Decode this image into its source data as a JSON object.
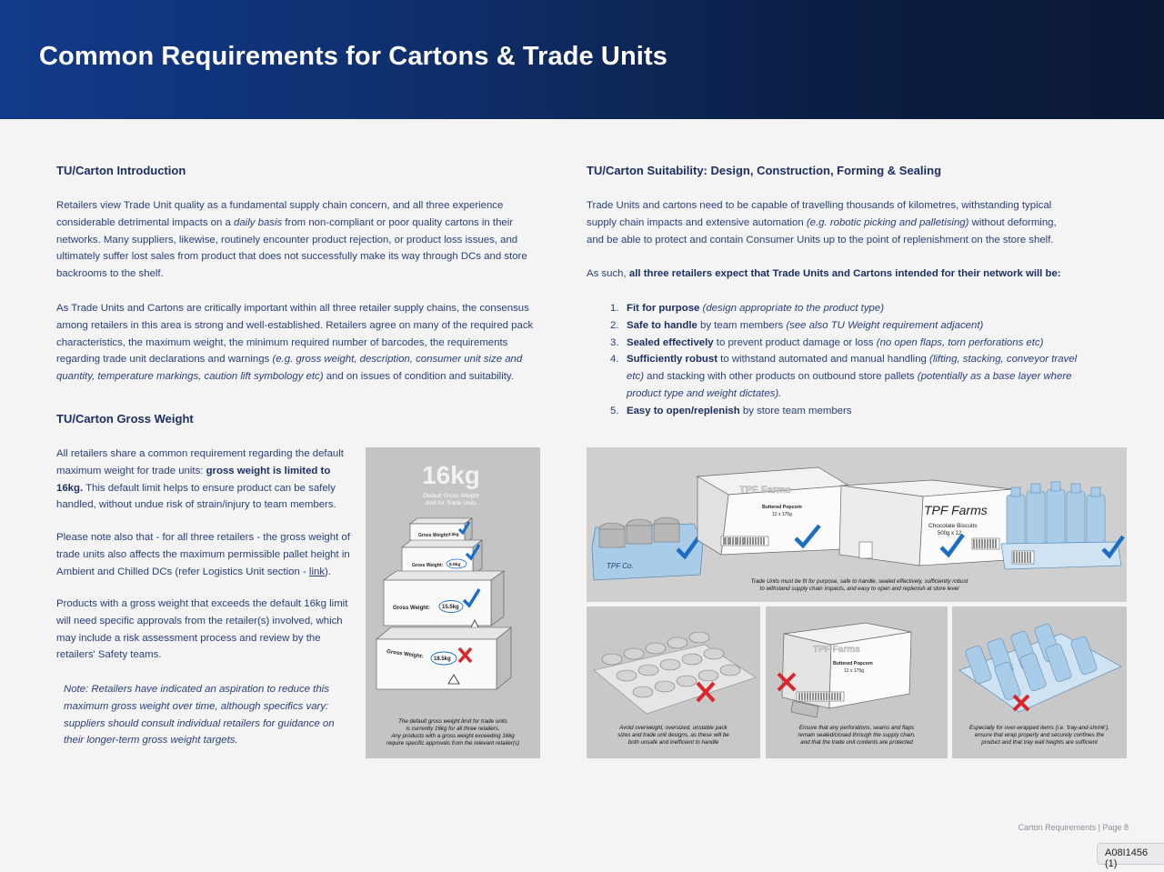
{
  "header": {
    "title": "Common Requirements for Cartons & Trade Units"
  },
  "left": {
    "intro_heading": "TU/Carton Introduction",
    "intro_p1_a": "Retailers view Trade Unit quality as a fundamental supply chain concern, and all three experience considerable detrimental impacts on a ",
    "intro_p1_i": "daily basis",
    "intro_p1_b": " from non-compliant or poor quality cartons in their networks.  Many suppliers, likewise, routinely encounter product rejection, or product loss issues, and ultimately suffer lost sales from product that does not successfully make its way through DCs and store backrooms to the shelf.",
    "intro_p2_a": "As Trade Units and Cartons are critically important within all three retailer supply chains, the consensus among retailers in this area is strong and well-established.  Retailers agree on many of the required pack characteristics, the maximum weight, the minimum required number of barcodes, the requirements regarding trade unit declarations and warnings ",
    "intro_p2_i": "(e.g. gross weight, description, consumer unit size and quantity, temperature markings, caution lift symbology etc)",
    "intro_p2_b": " and on issues of condition and suitability.",
    "weight_heading": "TU/Carton Gross Weight",
    "weight_p1_a": "All retailers share a common requirement regarding the default maximum weight for trade units: ",
    "weight_p1_b": "gross weight is limited to 16kg.",
    "weight_p1_c": "  This default limit helps to ensure product can be safely handled, without undue risk of strain/injury to team members.",
    "weight_p2_a": "Please note also that - for all three retailers - the gross weight of trade units also affects the maximum permissible pallet height in Ambient and Chilled DCs (refer Logistics Unit section - ",
    "weight_p2_link": "link",
    "weight_p2_b": ").",
    "weight_p3": "Products with a gross weight that exceeds the default 16kg limit will need specific approvals from the retailer(s) involved, which may include a risk assessment process and review by the retailers' Safety teams.",
    "note": "Note: Retailers have indicated an aspiration to reduce this maximum gross weight over time, although specifics vary: suppliers should consult individual retailers for guidance on their longer-term gross weight targets."
  },
  "weight_panel": {
    "big": "16kg",
    "sub1": "Default Gross Weight",
    "sub2": "limit for Trade Units",
    "boxes": [
      {
        "label": "Gross Weight:",
        "value": "3.5kg"
      },
      {
        "label": "Gross Weight:",
        "value": "8.5kg"
      },
      {
        "label": "Gross Weight:",
        "value": "15.5kg"
      },
      {
        "label": "Gross Weight:",
        "value": "18.5kg"
      }
    ],
    "caption_1": "The default gross weight limit for trade units",
    "caption_2": "is currently 16kg for all three retailers.",
    "caption_3": "Any products with a gross weight exceeding 16kg",
    "caption_4": "require specific approvals from the relevant retailer(s)"
  },
  "right": {
    "suit_heading": "TU/Carton Suitability: Design, Construction, Forming & Sealing",
    "suit_p1_a": "Trade Units and cartons need to be capable of travelling thousands of kilometres, withstanding typical supply chain impacts and extensive automation ",
    "suit_p1_i": "(e.g. robotic picking and palletising)",
    "suit_p1_b": " without deforming, and be able to protect and contain Consumer Units up to the point of replenishment on the store shelf.",
    "suit_p2_a": "As such, ",
    "suit_p2_b": "all three retailers expect that Trade Units and Cartons intended for their network will be:",
    "list": [
      {
        "num": "1.",
        "bold": "Fit for purpose",
        "rest": " ",
        "ital": "(design appropriate to the product type)",
        "tail": ""
      },
      {
        "num": "2.",
        "bold": "Safe to handle",
        "rest": " by team members ",
        "ital": "(see also TU Weight requirement adjacent)",
        "tail": ""
      },
      {
        "num": "3.",
        "bold": "Sealed effectively",
        "rest": " to prevent product damage or loss ",
        "ital": "(no open flaps, torn perforations etc)",
        "tail": ""
      },
      {
        "num": "4.",
        "bold": "Sufficiently robust",
        "rest": " to withstand automated and manual handling ",
        "ital": "(lifting, stacking, conveyor travel etc)",
        "tail": " and stacking with other products on outbound store pallets "
      },
      {
        "num": "5.",
        "bold": "Easy to open/replenish",
        "rest": " by store team members",
        "ital": "",
        "tail": ""
      }
    ],
    "list4_ital2": "(potentially as a base layer where product type and weight dictates).",
    "top_panel": {
      "brand1": "TPF Farms",
      "product1": "Buttered Popcorn",
      "pack1": "12 x 175g",
      "brand2": "TPF Farms",
      "product2": "Chocolate Biscuits",
      "pack2": "500g x 12",
      "brand3": "TPF Co.",
      "caption_1": "Trade Units must be fit for purpose, safe to handle, sealed effectively, sufficiently robust",
      "caption_2": "to withstand supply chain impacts, and easy to open and replenish at store level"
    },
    "bottom_panels": [
      {
        "caption_1": "Avoid overweight, oversized, unstable pack",
        "caption_2": "sizes and trade unit designs, as these will be",
        "caption_3": "both unsafe and inefficient to handle"
      },
      {
        "brand": "TPF Farms",
        "product": "Buttered Popcorn",
        "pack": "12 x 175g",
        "caption_1": "Ensure that any perforations, seams and flaps",
        "caption_2": "remain sealed/closed through the supply chain,",
        "caption_3": "and that the trade unit contents are protected"
      },
      {
        "caption_1": "Especially for over-wrapped items (i.e. 'tray-and-shrink'),",
        "caption_2": "ensure that wrap properly and securely confines the",
        "caption_3": "product and that tray wall heights are sufficient"
      }
    ]
  },
  "footer": {
    "page_label": "Carton Requirements | Page 8",
    "doc_tag": "A08I1456 (1)"
  },
  "colors": {
    "header_start": "#123a8a",
    "header_end": "#091833",
    "text": "#2a3f7a",
    "check": "#1a6fc4",
    "cross": "#d9262b"
  }
}
